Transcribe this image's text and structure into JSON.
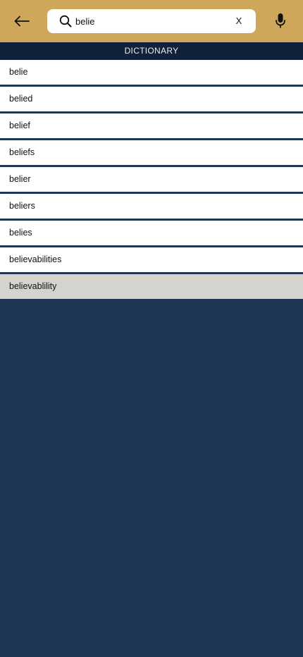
{
  "header": {
    "back_icon": "arrow-left-icon",
    "search_icon": "search-icon",
    "search_value": "belie",
    "clear_label": "X",
    "mic_icon": "microphone-icon"
  },
  "section": {
    "title": "DICTIONARY"
  },
  "results": [
    "belie",
    "belied",
    "belief",
    "beliefs",
    "belier",
    "beliers",
    "belies",
    "believabilities",
    "believablility"
  ],
  "colors": {
    "header_bg": "#cfa75a",
    "section_bg": "#11213a",
    "page_bg": "#1f3554",
    "highlight_row": "#d4d3cd"
  }
}
